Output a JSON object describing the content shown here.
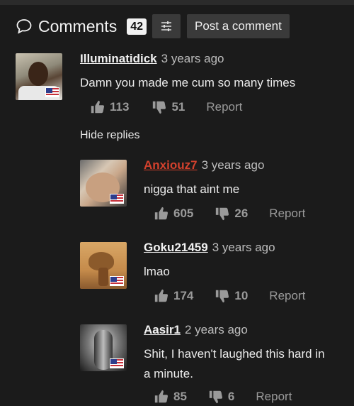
{
  "header": {
    "title": "Comments",
    "count": "42",
    "post_label": "Post a comment"
  },
  "hide_replies_label": "Hide replies",
  "report_label": "Report",
  "comments": [
    {
      "user": "Illuminatidick",
      "time": "3 years ago",
      "text": "Damn you made me cum so many times",
      "likes": "113",
      "dislikes": "51"
    },
    {
      "user": "Anxiouz7",
      "time": "3 years ago",
      "text": "nigga that aint me",
      "likes": "605",
      "dislikes": "26"
    },
    {
      "user": "Goku21459",
      "time": "3 years ago",
      "text": "lmao",
      "likes": "174",
      "dislikes": "10"
    },
    {
      "user": "Aasir1",
      "time": "2 years ago",
      "text_line1": "Shit, I haven't laughed this hard in",
      "text_line2": "a minute.",
      "likes": "85",
      "dislikes": "6"
    }
  ],
  "colors": {
    "background": "#1b1b1b",
    "button_bg": "#3a3a3a",
    "highlight_user": "#d3412d"
  }
}
